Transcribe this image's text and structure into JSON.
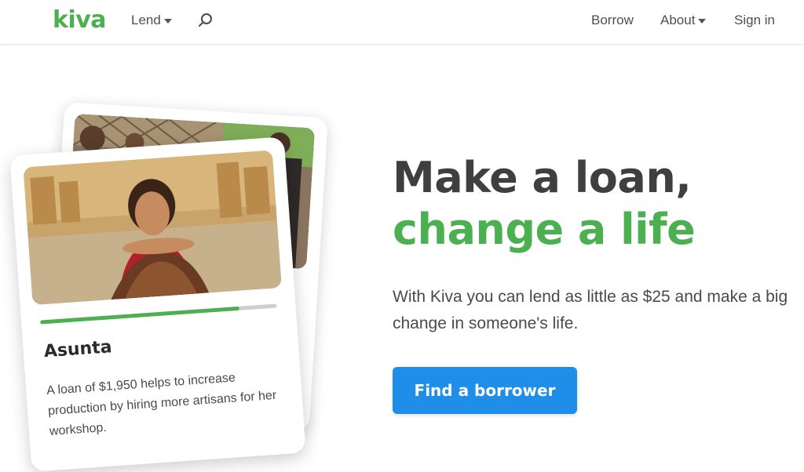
{
  "header": {
    "logo": "kiva",
    "nav_left": [
      {
        "label": "Lend",
        "has_dropdown": true
      }
    ],
    "search_icon": "search-icon",
    "nav_right": [
      {
        "label": "Borrow",
        "has_dropdown": false
      },
      {
        "label": "About",
        "has_dropdown": true
      },
      {
        "label": "Sign in",
        "has_dropdown": false
      }
    ]
  },
  "hero": {
    "headline_line1": "Make a loan,",
    "headline_line2": "change a life",
    "subtext": "With Kiva you can lend as little as $25 and make a big change in someone's life.",
    "cta_label": "Find a borrower"
  },
  "loan_card": {
    "borrower_name": "Asunta",
    "description": "A loan of $1,950 helps to increase production by hiring more artisans for her workshop.",
    "progress_fraction": 0.84
  },
  "colors": {
    "brand_green": "#4caf50",
    "cta_blue": "#1f8ee8",
    "headline_dark": "#3f3f3f"
  }
}
